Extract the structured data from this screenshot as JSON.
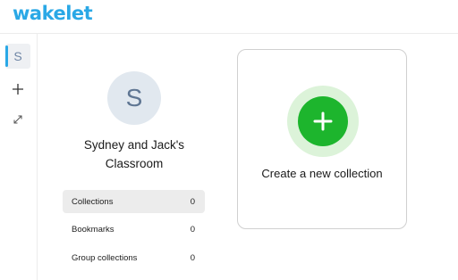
{
  "header": {
    "logo_text": "wakelet",
    "brand_color": "#2aa8e6"
  },
  "rail": {
    "space_letter": "S",
    "items": [
      {
        "icon": "space-avatar-icon",
        "active": true
      },
      {
        "icon": "plus-icon"
      },
      {
        "icon": "expand-icon"
      }
    ]
  },
  "profile": {
    "avatar_letter": "S",
    "name": "Sydney and Jack's Classroom"
  },
  "stats": [
    {
      "label": "Collections",
      "count": "0",
      "active": true
    },
    {
      "label": "Bookmarks",
      "count": "0"
    },
    {
      "label": "Group collections",
      "count": "0"
    }
  ],
  "create": {
    "label": "Create a new collection",
    "accent_color": "#1db52d",
    "halo_color": "#dcf3d9",
    "icon": "plus-icon"
  }
}
